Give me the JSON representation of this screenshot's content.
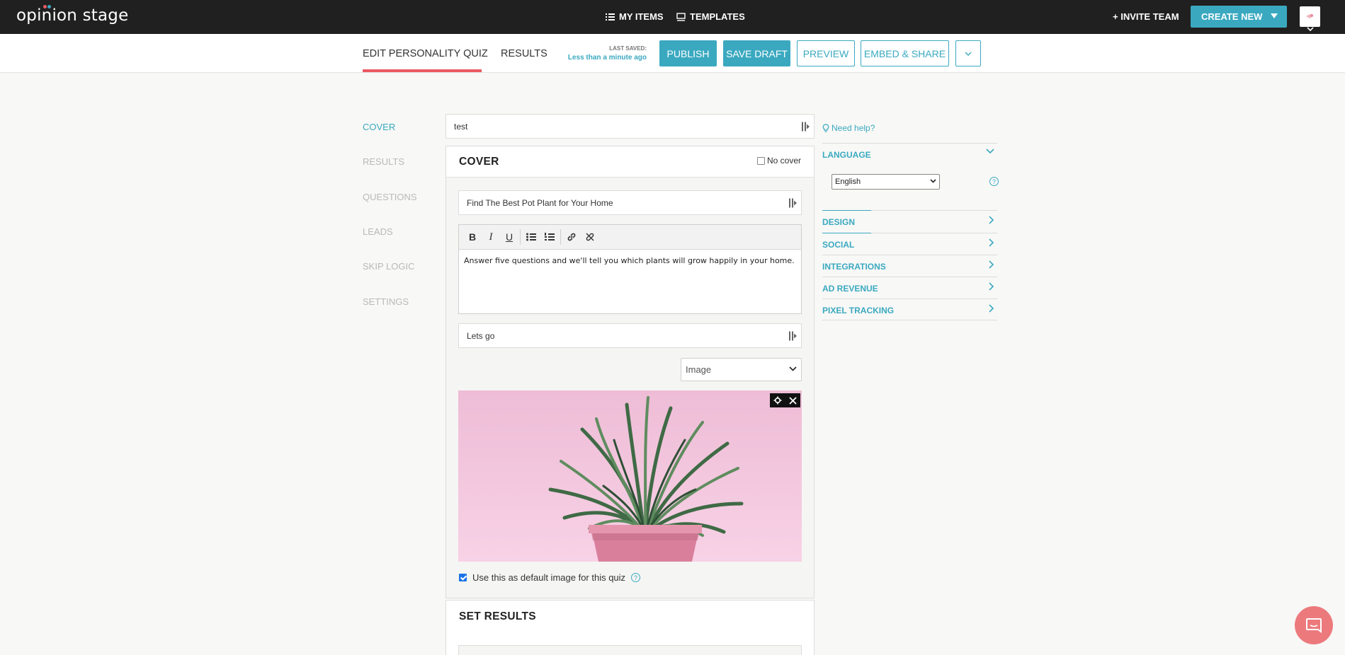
{
  "topbar": {
    "logo": "opinion stage",
    "my_items": "MY ITEMS",
    "templates": "TEMPLATES",
    "invite_team": "+ INVITE TEAM",
    "create_new": "CREATE NEW"
  },
  "subbar": {
    "tab_edit": "EDIT PERSONALITY QUIZ",
    "tab_results": "RESULTS",
    "last_saved_label": "LAST SAVED:",
    "last_saved_value": "Less than a minute ago",
    "publish": "PUBLISH",
    "save_draft": "SAVE DRAFT",
    "preview": "PREVIEW",
    "embed_share": "EMBED & SHARE"
  },
  "leftnav": {
    "items": [
      {
        "label": "COVER",
        "active": true
      },
      {
        "label": "RESULTS",
        "active": false
      },
      {
        "label": "QUESTIONS",
        "active": false
      },
      {
        "label": "LEADS",
        "active": false
      },
      {
        "label": "SKIP LOGIC",
        "active": false
      },
      {
        "label": "SETTINGS",
        "active": false
      }
    ]
  },
  "main": {
    "quiz_name": "test",
    "cover": {
      "title": "COVER",
      "no_cover_label": "No cover",
      "no_cover_checked": false,
      "headline": "Find The Best Pot Plant for Your Home",
      "description": "Answer five questions and we'll tell you which plants will grow happily in your home.",
      "button_text": "Lets go",
      "media_type": "Image",
      "default_image_label": "Use this as default image for this quiz",
      "default_image_checked": true
    },
    "set_results_title": "SET RESULTS"
  },
  "sidebar": {
    "need_help": "Need help?",
    "language_label": "LANGUAGE",
    "language_value": "English",
    "sections": [
      "DESIGN",
      "SOCIAL",
      "INTEGRATIONS",
      "AD REVENUE",
      "PIXEL TRACKING"
    ]
  },
  "colors": {
    "accent": "#3aa9c0",
    "topbar": "#202020",
    "tab_underline": "#ec5a62",
    "chat": "#ec7a7d"
  }
}
